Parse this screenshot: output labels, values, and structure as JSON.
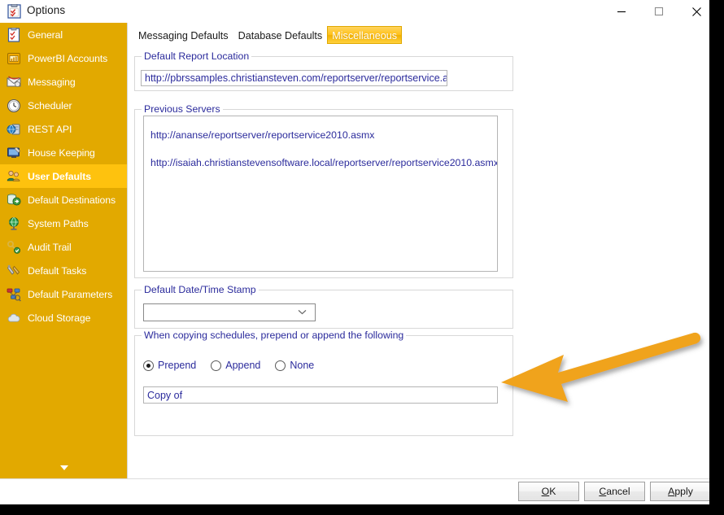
{
  "window": {
    "title": "Options",
    "title_icon": "checklist-icon",
    "controls": {
      "minimize": "minimize-icon",
      "maximize": "maximize-icon",
      "close": "close-icon"
    }
  },
  "sidebar": {
    "items": [
      {
        "label": "General",
        "icon": "clipboard-icon",
        "selected": false
      },
      {
        "label": "PowerBI Accounts",
        "icon": "powerbi-icon",
        "selected": false
      },
      {
        "label": "Messaging",
        "icon": "envelope-icon",
        "selected": false
      },
      {
        "label": "Scheduler",
        "icon": "clock-icon",
        "selected": false
      },
      {
        "label": "REST API",
        "icon": "server-globe-icon",
        "selected": false
      },
      {
        "label": "House Keeping",
        "icon": "monitor-icon",
        "selected": false
      },
      {
        "label": "User Defaults",
        "icon": "users-icon",
        "selected": true
      },
      {
        "label": "Default Destinations",
        "icon": "database-arrow-icon",
        "selected": false
      },
      {
        "label": "System Paths",
        "icon": "globe-icon",
        "selected": false
      },
      {
        "label": "Audit Trail",
        "icon": "key-check-icon",
        "selected": false
      },
      {
        "label": "Default Tasks",
        "icon": "tools-icon",
        "selected": false
      },
      {
        "label": "Default Parameters",
        "icon": "nodes-icon",
        "selected": false
      },
      {
        "label": "Cloud Storage",
        "icon": "cloud-icon",
        "selected": false
      }
    ],
    "scroll_down": "chevron-down-icon"
  },
  "tabs": [
    {
      "label": "Messaging Defaults",
      "active": false
    },
    {
      "label": "Database Defaults",
      "active": false
    },
    {
      "label": "Miscellaneous",
      "active": true
    }
  ],
  "groups": {
    "default_report_location": {
      "legend": "Default Report Location",
      "value": "http://pbrssamples.christiansteven.com/reportserver/reportservice.asmx",
      "placeholder": ""
    },
    "previous_servers": {
      "legend": "Previous Servers",
      "items": [
        "http://ananse/reportserver/reportservice2010.asmx",
        "http://isaiah.christianstevensoftware.local/reportserver/reportservice2010.asmx"
      ]
    },
    "default_datetime_stamp": {
      "legend": "Default Date/Time Stamp",
      "value": "",
      "chevron": "chevron-down-icon"
    },
    "copy_schedules": {
      "legend": "When copying schedules, prepend or append the following",
      "options": [
        {
          "label": "Prepend",
          "checked": true
        },
        {
          "label": "Append",
          "checked": false
        },
        {
          "label": "None",
          "checked": false
        }
      ],
      "text_value": "Copy of",
      "text_placeholder": ""
    }
  },
  "footer": {
    "buttons": [
      {
        "accesskey": "O",
        "rest": "K"
      },
      {
        "accesskey": "C",
        "rest": "ancel"
      },
      {
        "accesskey": "A",
        "rest": "pply"
      }
    ]
  },
  "annotation": {
    "arrow": "left-pointing-arrow",
    "color": "#F0A31E"
  },
  "colors": {
    "sidebar_bg": "#E2A900",
    "sidebar_selected": "#FEC20E",
    "tab_active": "#FFC21C",
    "field_text": "#2B2B9C",
    "legend_text": "#2B2B9C"
  }
}
